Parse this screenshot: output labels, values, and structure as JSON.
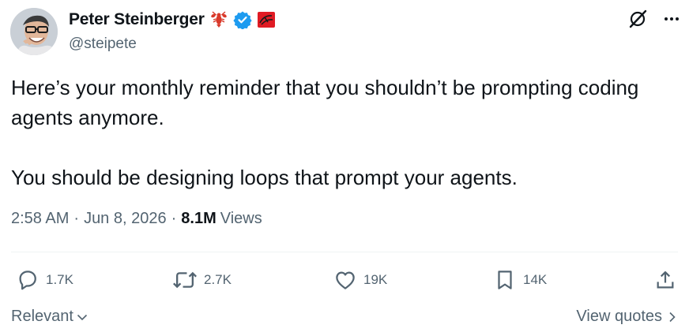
{
  "author": {
    "display_name": "Peter Steinberger",
    "handle": "@steipete",
    "badges": [
      "lobster-emoji-icon",
      "verified-badge-icon",
      "affiliate-badge-icon"
    ]
  },
  "tweet": {
    "paragraphs": [
      "Here’s your monthly reminder that you shouldn’t be prompting coding agents anymore.",
      "You should be designing loops that prompt your agents."
    ]
  },
  "meta": {
    "time": "2:58 AM",
    "separator": "·",
    "date": "Jun 8, 2026",
    "views_count": "8.1M",
    "views_label": "Views"
  },
  "actions": {
    "replies": "1.7K",
    "reposts": "2.7K",
    "likes": "19K",
    "bookmarks": "14K"
  },
  "footer": {
    "sort_label": "Relevant",
    "view_quotes_label": "View quotes"
  },
  "colors": {
    "text": "#0f1419",
    "secondary": "#536471",
    "verified": "#1d9bf0",
    "divider": "#eff3f4"
  }
}
